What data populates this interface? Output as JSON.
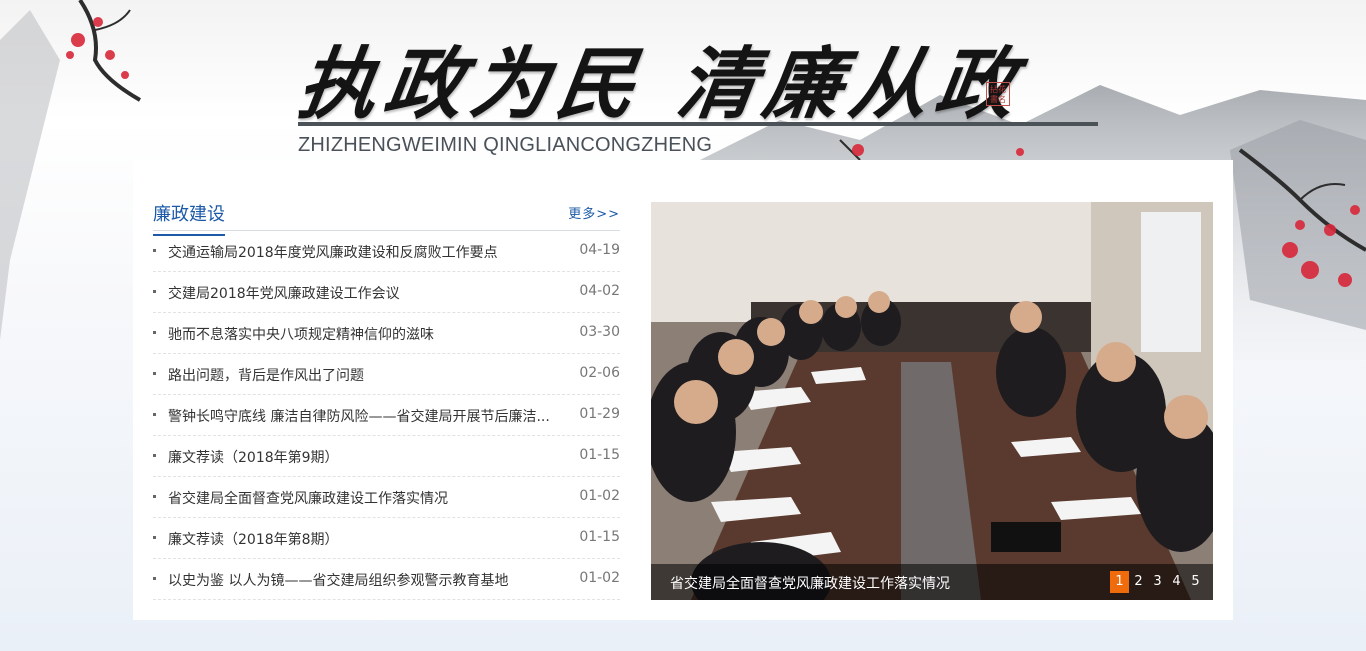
{
  "header": {
    "slogan": "执政为民  清廉从政",
    "pinyin": "ZHIZHENGWEIMIN QINGLIANCONGZHENG",
    "seal_text": "拈花書名"
  },
  "news": {
    "title": "廉政建设",
    "more": "更多>>",
    "items": [
      {
        "text": "交通运输局2018年度党风廉政建设和反腐败工作要点",
        "date": "04-19"
      },
      {
        "text": "交建局2018年党风廉政建设工作会议",
        "date": "04-02"
      },
      {
        "text": "驰而不息落实中央八项规定精神信仰的滋味",
        "date": "03-30"
      },
      {
        "text": "路出问题，背后是作风出了问题",
        "date": "02-06"
      },
      {
        "text": "警钟长鸣守底线 廉洁自律防风险——省交建局开展节后廉洁...",
        "date": "01-29"
      },
      {
        "text": "廉文荐读（2018年第9期）",
        "date": "01-15"
      },
      {
        "text": "省交建局全面督查党风廉政建设工作落实情况",
        "date": "01-02"
      },
      {
        "text": "廉文荐读（2018年第8期）",
        "date": "01-15"
      },
      {
        "text": "以史为鉴 以人为镜——省交建局组织参观警示教育基地",
        "date": "01-02"
      }
    ]
  },
  "slider": {
    "caption": "省交建局全面督查党风廉政建设工作落实情况",
    "pages": [
      "1",
      "2",
      "3",
      "4",
      "5"
    ],
    "active_page": "1"
  },
  "colors": {
    "accent": "#1c5aa8",
    "pager_active": "#f06b0c"
  }
}
